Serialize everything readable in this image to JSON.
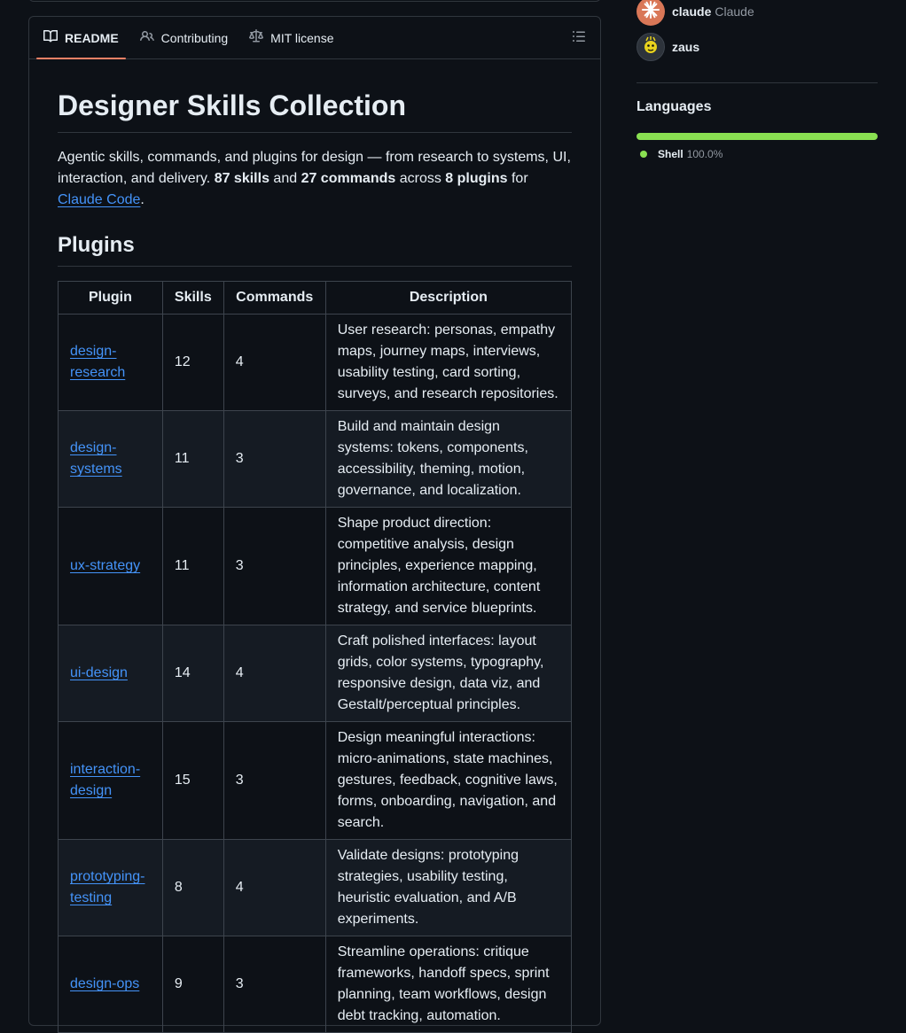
{
  "tabs": [
    {
      "label": "README",
      "icon": "book-icon",
      "active": true
    },
    {
      "label": "Contributing",
      "icon": "people-icon",
      "active": false
    },
    {
      "label": "MIT license",
      "icon": "law-icon",
      "active": false
    }
  ],
  "readme": {
    "title": "Designer Skills Collection",
    "intro": {
      "text1": "Agentic skills, commands, and plugins for design — from research to systems, UI, interaction, and delivery. ",
      "skills_strong": "87 skills",
      "and": " and ",
      "commands_strong": "27 commands",
      "across": " across ",
      "plugins_strong": "8 plugins",
      "for": " for ",
      "link": "Claude Code",
      "period": "."
    },
    "plugins_heading": "Plugins",
    "table": {
      "headers": [
        "Plugin",
        "Skills",
        "Commands",
        "Description"
      ],
      "rows": [
        {
          "plugin": "design-research",
          "skills": "12",
          "commands": "4",
          "description": "User research: personas, empathy maps, journey maps, interviews, usability testing, card sorting, surveys, and research repositories."
        },
        {
          "plugin": "design-systems",
          "skills": "11",
          "commands": "3",
          "description": "Build and maintain design systems: tokens, components, accessibility, theming, motion, governance, and localization."
        },
        {
          "plugin": "ux-strategy",
          "skills": "11",
          "commands": "3",
          "description": "Shape product direction: competitive analysis, design principles, experience mapping, information architecture, content strategy, and service blueprints."
        },
        {
          "plugin": "ui-design",
          "skills": "14",
          "commands": "4",
          "description": "Craft polished interfaces: layout grids, color systems, typography, responsive design, data viz, and Gestalt/perceptual principles."
        },
        {
          "plugin": "interaction-design",
          "skills": "15",
          "commands": "3",
          "description": "Design meaningful interactions: micro-animations, state machines, gestures, feedback, cognitive laws, forms, onboarding, navigation, and search."
        },
        {
          "plugin": "prototyping-testing",
          "skills": "8",
          "commands": "4",
          "description": "Validate designs: prototyping strategies, usability testing, heuristic evaluation, and A/B experiments."
        },
        {
          "plugin": "design-ops",
          "skills": "9",
          "commands": "3",
          "description": "Streamline operations: critique frameworks, handoff specs, sprint planning, team workflows, design debt tracking, automation."
        }
      ]
    }
  },
  "sidebar": {
    "contributors": [
      {
        "login": "claude",
        "name": "Claude"
      },
      {
        "login": "zaus",
        "name": ""
      }
    ],
    "languages_heading": "Languages",
    "languages": [
      {
        "name": "Shell",
        "percent": "100.0%",
        "fraction": 1.0,
        "color": "#89e051"
      }
    ]
  },
  "colors": {
    "accent_tab": "#f78166",
    "link": "#4493f8",
    "shell": "#89e051"
  }
}
